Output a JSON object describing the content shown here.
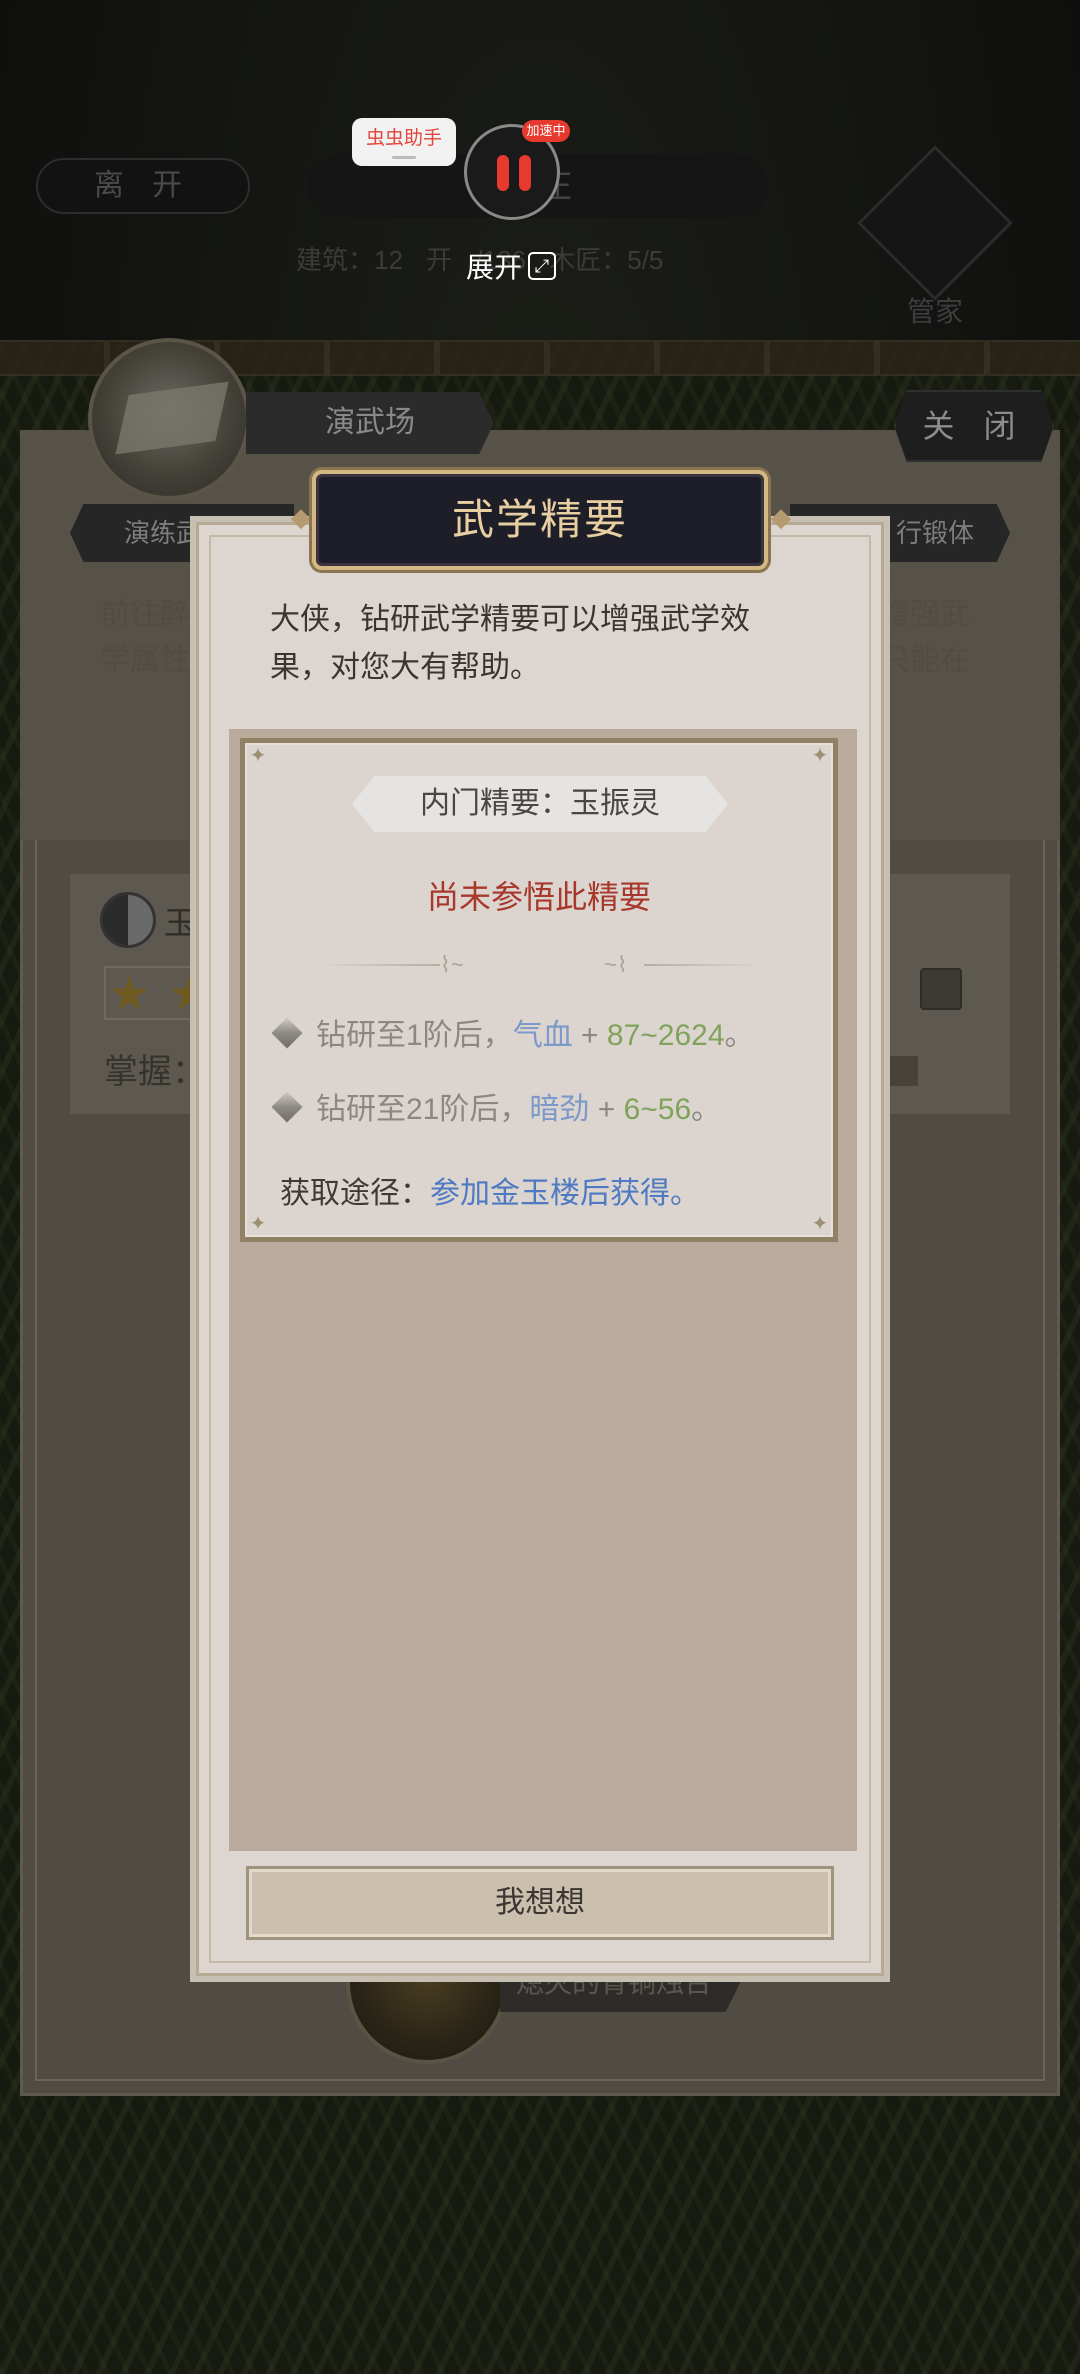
{
  "background": {
    "leave_button": "离 开",
    "manor_title": "山庄",
    "stats": [
      "建筑：12",
      "开",
      "/136",
      "木匠：5/5"
    ],
    "steward_label": "管家",
    "arena_label": "演武场",
    "close_button": "关 闭",
    "tab_left": "演练武",
    "tab_right": "行锻体",
    "desc_left": "前往醉 学属性",
    "desc_right": "增强武 只能在",
    "card_name": "玉",
    "card_master_label": "掌握：",
    "bronze_label": "熄灭的青铜烛台"
  },
  "helper": {
    "tag": "虫虫助手",
    "badge": "加速中",
    "expand_label": "展开"
  },
  "modal": {
    "title": "武学精要",
    "intro": "大侠，钻研武学精要可以增强武学效果，对您大有帮助。",
    "essence_name": "内门精要：玉振灵",
    "status": "尚未参悟此精要",
    "effects": [
      {
        "prefix": "钻研至1阶后，",
        "attr": "气血",
        "plus": " + ",
        "value": "87~2624",
        "suffix": "。"
      },
      {
        "prefix": "钻研至21阶后，",
        "attr": "暗劲",
        "plus": " + ",
        "value": "6~56",
        "suffix": "。"
      }
    ],
    "source_label": "获取途径：",
    "source_value": "参加金玉楼后获得。",
    "ponder_button": "我想想"
  },
  "colors": {
    "title_gold": "#e7cfa1",
    "status_red": "#a8372c",
    "attr_blue": "#7b99c9",
    "value_green": "#7fa35b",
    "link_blue": "#4d7ac2"
  }
}
